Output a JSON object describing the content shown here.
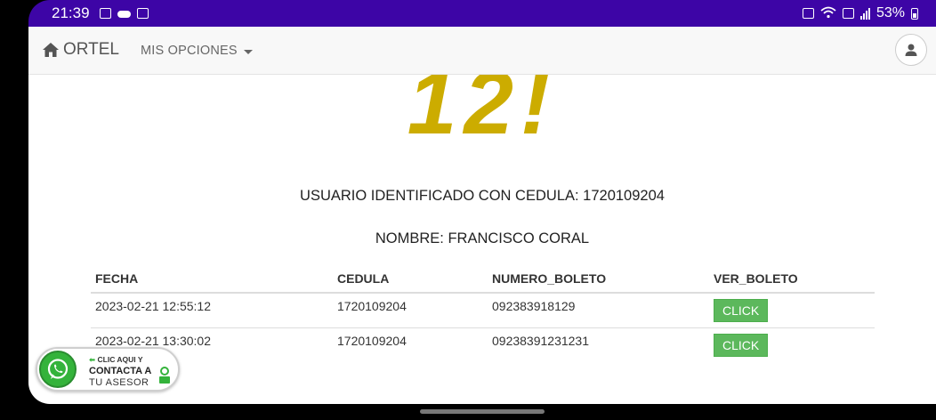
{
  "status_bar": {
    "time": "21:39",
    "battery": "53%",
    "left_icons": [
      "image-icon",
      "cloud-icon",
      "cast-icon"
    ],
    "right_icons": [
      "nfc-icon",
      "wifi-icon",
      "volte-icon",
      "signal-icon",
      "battery-icon"
    ]
  },
  "navbar": {
    "brand": "ORTEL",
    "menu_label": "MIS OPCIONES",
    "icons": [
      "home-icon",
      "user-icon"
    ]
  },
  "hero": {
    "text": "12!"
  },
  "info": {
    "identified": "USUARIO IDENTIFICADO CON CEDULA: 1720109204",
    "name": "NOMBRE: FRANCISCO CORAL"
  },
  "table": {
    "headers": {
      "fecha": "FECHA",
      "cedula": "CEDULA",
      "numero_boleto": "NUMERO_BOLETO",
      "ver_boleto": "VER_BOLETO"
    },
    "rows": [
      {
        "fecha": "2023-02-21 12:55:12",
        "cedula": "1720109204",
        "numero_boleto": "092383918129",
        "action": "CLICK"
      },
      {
        "fecha": "2023-02-21 13:30:02",
        "cedula": "1720109204",
        "numero_boleto": "09238391231231",
        "action": "CLICK"
      }
    ]
  },
  "whatsapp_badge": {
    "line1": "CLIC AQUI Y",
    "line2": "CONTACTA A",
    "line3": "TU ASESOR"
  },
  "colors": {
    "status_bar": "#3d05a6",
    "hero": "#ccac00",
    "button": "#5cb85c",
    "whatsapp": "#34b33b"
  }
}
